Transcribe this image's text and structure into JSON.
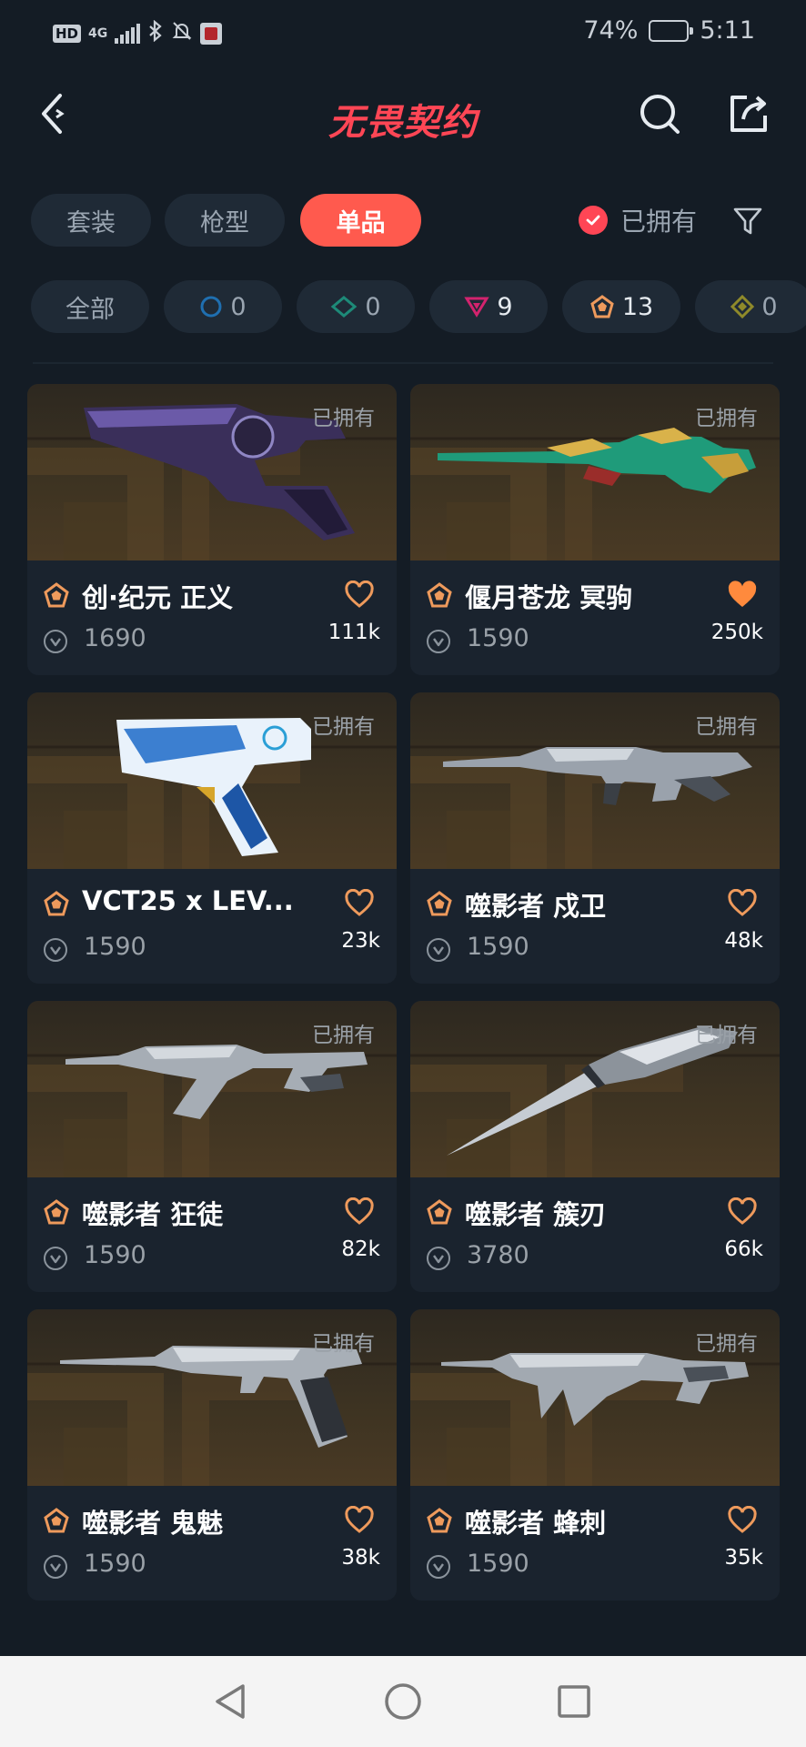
{
  "status_bar": {
    "hd": "HD",
    "network": "4G",
    "battery_text": "74%",
    "battery_level": 0.74,
    "time": "5:11",
    "icons": [
      "signal-icon",
      "bluetooth-icon",
      "mute-bell-icon",
      "app-notification-icon",
      "battery-icon"
    ]
  },
  "header": {
    "title": "无畏契约",
    "back_icon": "chevron-left-icon",
    "search_icon": "search-icon",
    "share_icon": "share-icon"
  },
  "tabs": {
    "items": [
      {
        "label": "套装",
        "active": false
      },
      {
        "label": "枪型",
        "active": false
      },
      {
        "label": "单品",
        "active": true
      }
    ],
    "owned_label": "已拥有",
    "owned_checked": true,
    "filter_icon": "filter-icon"
  },
  "rarity_chips": [
    {
      "label": "全部",
      "icon": null,
      "color": null
    },
    {
      "label": "0",
      "icon": "circle-tier-icon",
      "color": "#1f6fb0"
    },
    {
      "label": "0",
      "icon": "diamond-tier-icon",
      "color": "#1d8a78"
    },
    {
      "label": "9",
      "icon": "triangle-tier-icon",
      "color": "#d3236e"
    },
    {
      "label": "13",
      "icon": "pentagon-tier-icon",
      "color": "#ee9a5c"
    },
    {
      "label": "0",
      "icon": "rhombus-tier-icon",
      "color": "#8f8a2a"
    }
  ],
  "cards": [
    {
      "name": "创·纪元 正义",
      "price": "1690",
      "likes": "111k",
      "owned_label": "已拥有",
      "liked": false,
      "weapon": "revolver"
    },
    {
      "name": "偃月苍龙 冥驹",
      "price": "1590",
      "likes": "250k",
      "owned_label": "已拥有",
      "liked": true,
      "weapon": "sniper"
    },
    {
      "name": "VCT25 x LEV...",
      "price": "1590",
      "likes": "23k",
      "owned_label": "已拥有",
      "liked": false,
      "weapon": "pistol"
    },
    {
      "name": "噬影者 戍卫",
      "price": "1590",
      "likes": "48k",
      "owned_label": "已拥有",
      "liked": false,
      "weapon": "rifle"
    },
    {
      "name": "噬影者 狂徒",
      "price": "1590",
      "likes": "82k",
      "owned_label": "已拥有",
      "liked": false,
      "weapon": "rifle2"
    },
    {
      "name": "噬影者 簇刃",
      "price": "3780",
      "likes": "66k",
      "owned_label": "已拥有",
      "liked": false,
      "weapon": "knife"
    },
    {
      "name": "噬影者 鬼魅",
      "price": "1590",
      "likes": "38k",
      "owned_label": "已拥有",
      "liked": false,
      "weapon": "pistol2"
    },
    {
      "name": "噬影者 蜂刺",
      "price": "1590",
      "likes": "35k",
      "owned_label": "已拥有",
      "liked": false,
      "weapon": "smg"
    }
  ],
  "colors": {
    "background": "#141c25",
    "accent": "#ff4655",
    "tier_orange": "#ee9a5c",
    "liked_heart": "#ff8a3d"
  },
  "navbar": {
    "icons": [
      "nav-back-icon",
      "nav-home-icon",
      "nav-recents-icon"
    ]
  }
}
